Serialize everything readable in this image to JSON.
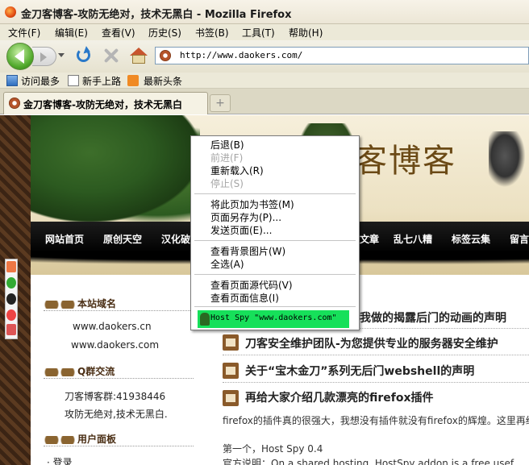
{
  "window": {
    "title": "金刀客博客-攻防无绝对，技术无黑白 - Mozilla Firefox"
  },
  "menubar": {
    "items": [
      "文件(F)",
      "编辑(E)",
      "查看(V)",
      "历史(S)",
      "书签(B)",
      "工具(T)",
      "帮助(H)"
    ]
  },
  "navigation": {
    "url": "http://www.daokers.com/"
  },
  "bookmarks": {
    "items": [
      "访问最多",
      "新手上路",
      "最新头条"
    ]
  },
  "tabs": {
    "active_label": "金刀客博客-攻防无绝对，技术无黑白",
    "new_tab_symbol": "+"
  },
  "site": {
    "logo_text": "客博客",
    "nav": [
      "网站首页",
      "原创天空",
      "汉化破",
      "文章",
      "乱七八糟",
      "标签云集",
      "留言"
    ],
    "sidebar": {
      "domain_title": "本站域名",
      "domains": [
        "www.daokers.cn",
        "www.daokers.com"
      ],
      "qq_title": "Q群交流",
      "qq_lines": [
        "刀客博客群:41938446",
        "攻防无绝对,技术无黑白."
      ],
      "user_title": "用户面板",
      "user_items": [
        "登录"
      ]
    },
    "posts": [
      "我做的揭露后门的动画的声明",
      "刀客安全维护团队-为您提供专业的服务器安全维护",
      "关于“宝木金刀”系列无后门webshell的声明",
      "再给大家介绍几款漂亮的firefox插件"
    ],
    "post_body": [
      "firefox的插件真的很强大，我想没有插件就没有firefox的辉煌。这里再给",
      "第一个，Host Spy  0.4",
      "官方说明：On a shared hosting, HostSpy addon is a free usef"
    ]
  },
  "context_menu": {
    "items": [
      {
        "label": "后退(B)",
        "enabled": true
      },
      {
        "label": "前进(F)",
        "enabled": false
      },
      {
        "label": "重新载入(R)",
        "enabled": true
      },
      {
        "label": "停止(S)",
        "enabled": false
      },
      {
        "label": "将此页加为书签(M)",
        "enabled": true
      },
      {
        "label": "页面另存为(P)...",
        "enabled": true
      },
      {
        "label": "发送页面(E)...",
        "enabled": true
      },
      {
        "label": "查看背景图片(W)",
        "enabled": true
      },
      {
        "label": "全选(A)",
        "enabled": true
      },
      {
        "label": "查看页面源代码(V)",
        "enabled": true
      },
      {
        "label": "查看页面信息(I)",
        "enabled": true
      }
    ],
    "host_spy": "Host Spy \"www.daokers.com\""
  },
  "colors": {
    "highlight": "#16e05a",
    "nav_bar": "#000000",
    "disabled_text": "#a6a6a6"
  }
}
